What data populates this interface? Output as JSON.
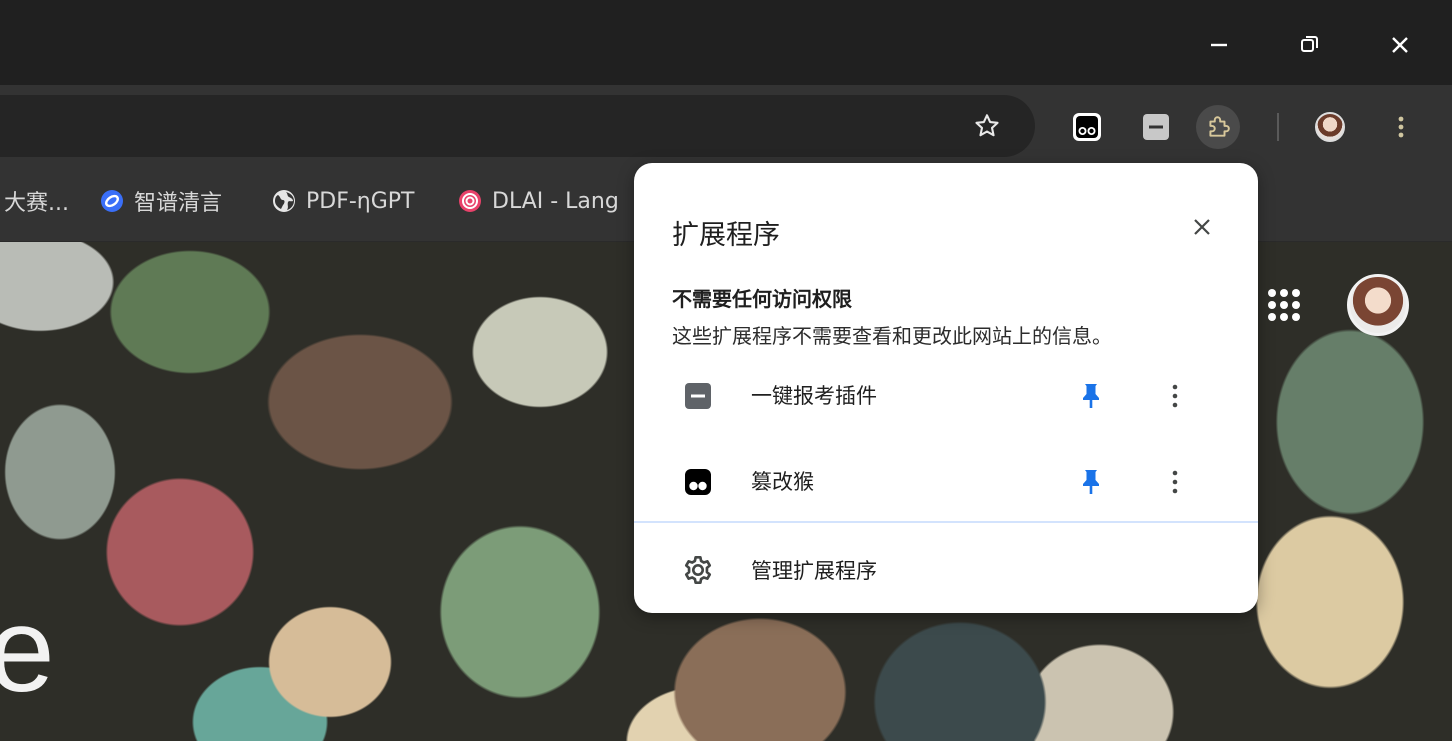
{
  "window": {
    "minimize_icon": "minimize-icon",
    "restore_icon": "restore-icon",
    "close_icon": "close-icon"
  },
  "toolbar": {
    "bookmark_star_icon": "star-outline-icon",
    "extensions_pinned": [
      "tampermonkey-icon",
      "exam-plugin-icon"
    ],
    "extensions_button_icon": "puzzle-icon",
    "menu_icon": "kebab-menu-icon"
  },
  "bookmarks": [
    {
      "label": "大赛...",
      "icon": "none"
    },
    {
      "label": "智谱清言",
      "icon": "zhipu-logo-icon",
      "color": "#3a6ff8"
    },
    {
      "label": "PDF-ηGPT",
      "icon": "globe-icon"
    },
    {
      "label": "DLAI - Lang",
      "icon": "dlai-logo-icon",
      "color": "#e8426a"
    }
  ],
  "page": {
    "partial_text": "e"
  },
  "extensions_popup": {
    "title": "扩展程序",
    "section_heading": "不需要任何访问权限",
    "section_description": "这些扩展程序不需要查看和更改此网站上的信息。",
    "extensions": [
      {
        "name": "一键报考插件",
        "icon": "exam-plugin-icon",
        "pinned": true
      },
      {
        "name": "篡改猴",
        "icon": "tampermonkey-icon",
        "pinned": true
      }
    ],
    "manage_label": "管理扩展程序",
    "accent_color": "#1a73e8"
  }
}
